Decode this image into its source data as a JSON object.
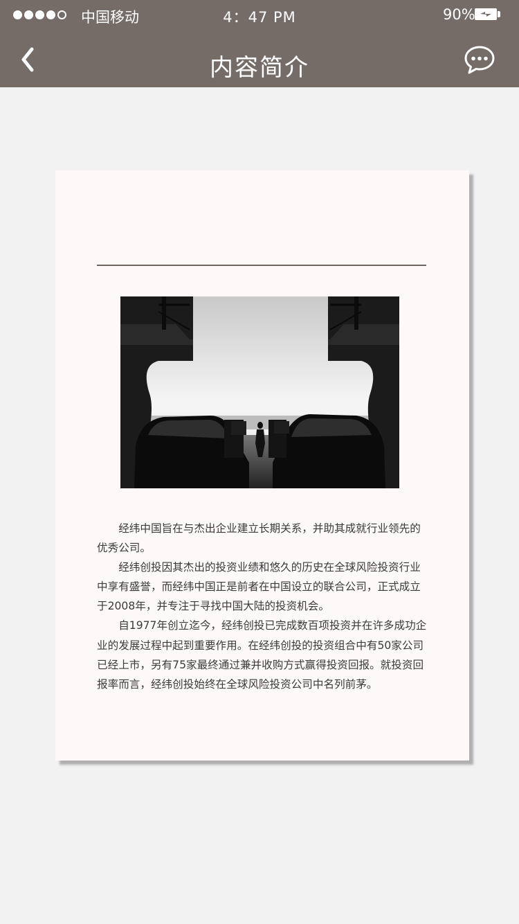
{
  "status_bar": {
    "signal": {
      "filled": 4,
      "total": 5
    },
    "carrier": "中国移动",
    "time": "4：47 PM",
    "battery": "90%"
  },
  "nav": {
    "back_icon": "chevron-left-icon",
    "title": "内容简介",
    "chat_icon": "chat-bubble-icon"
  },
  "card": {
    "image": "black-and-white photo of cars on a ferry deck",
    "paragraphs": [
      "经纬中国旨在与杰出企业建立长期关系，并助其成就行业领先的优秀公司。",
      "经纬创投因其杰出的投资业绩和悠久的历史在全球风险投资行业中享有盛誉，而经纬中国正是前者在中国设立的联合公司，正式成立于2008年，并专注于寻找中国大陆的投资机会。",
      "自1977年创立迄今，经纬创投已完成数百项投资并在许多成功企业的发展过程中起到重要作用。在经纬创投的投资组合中有50家公司已经上市，另有75家最终通过兼并收购方式赢得投资回报。就投资回报率而言，经纬创投始终在全球风险投资公司中名列前茅。"
    ]
  },
  "colors": {
    "header": "#756c68",
    "background": "#f3f2f3",
    "card": "#fdf9f8",
    "text": "#3a3a3a"
  }
}
